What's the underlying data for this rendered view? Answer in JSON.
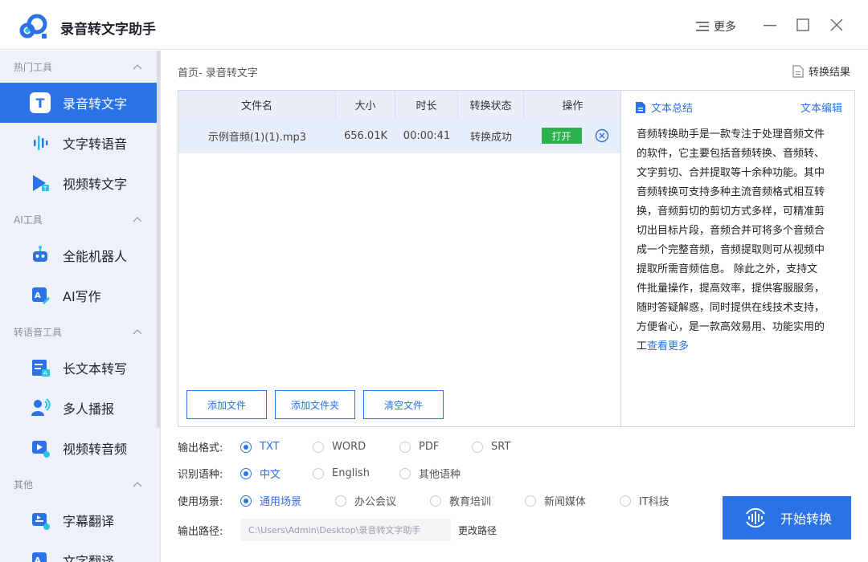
{
  "app": {
    "title": "录音转文字助手"
  },
  "titlebar": {
    "more_label": "更多"
  },
  "sidebar": {
    "sections": [
      {
        "title": "热门工具",
        "items": [
          {
            "label": "录音转文字",
            "icon": "T",
            "active": true
          },
          {
            "label": "文字转语音",
            "icon": "tts-icon"
          },
          {
            "label": "视频转文字",
            "icon": "video-text-icon"
          }
        ]
      },
      {
        "title": "AI工具",
        "items": [
          {
            "label": "全能机器人",
            "icon": "robot-icon"
          },
          {
            "label": "AI写作",
            "icon": "ai-write-icon"
          }
        ]
      },
      {
        "title": "转语音工具",
        "items": [
          {
            "label": "长文本转写",
            "icon": "long-text-icon"
          },
          {
            "label": "多人播报",
            "icon": "multi-speaker-icon"
          },
          {
            "label": "视频转音频",
            "icon": "video-audio-icon"
          }
        ]
      },
      {
        "title": "其他",
        "items": [
          {
            "label": "字幕翻译",
            "icon": "subtitle-icon"
          },
          {
            "label": "文字翻译",
            "icon": "translate-icon"
          }
        ]
      }
    ]
  },
  "main": {
    "breadcrumb": "首页- 录音转文字",
    "result_link": "转换结果"
  },
  "table": {
    "headers": [
      "文件名",
      "大小",
      "时长",
      "转换状态",
      "操作"
    ],
    "rows": [
      {
        "name": "示例音频(1)(1).mp3",
        "size": "656.01K",
        "duration": "00:00:41",
        "status": "转换成功",
        "action": "打开"
      }
    ]
  },
  "file_buttons": {
    "add_file": "添加文件",
    "add_folder": "添加文件夹",
    "clear": "清空文件"
  },
  "summary": {
    "title": "文本总结",
    "edit": "文本编辑",
    "lines": [
      "音频转换助手是一款专注于处理音频文件",
      "的软件，它主要包括音频转换、音频转、",
      "文字剪切、合并提取等十余种功能。其中",
      "音频转换可支持多种主流音频格式相互转",
      "换，音频剪切的剪切方式多样，可精准剪",
      "切出目标片段，音频合并可将多个音频合",
      "成一个完整音频，音频提取则可从视频中",
      "提取所需音频信息。 除此之外，支持文",
      "件批量操作，提高效率，提供客服服务，",
      "随时答疑解惑，同时提供在线技术支持，",
      "方便省心，是一款高效易用、功能实用的"
    ],
    "last_line": "工",
    "see_more": "查看更多"
  },
  "options": {
    "format": {
      "label": "输出格式:",
      "choices": [
        "TXT",
        "WORD",
        "PDF",
        "SRT"
      ],
      "selected": "TXT"
    },
    "language": {
      "label": "识别语种:",
      "choices": [
        "中文",
        "English",
        "其他语种"
      ],
      "selected": "中文"
    },
    "scene": {
      "label": "使用场景:",
      "choices": [
        "通用场景",
        "办公会议",
        "教育培训",
        "新闻媒体",
        "IT科技"
      ],
      "selected": "通用场景"
    },
    "path": {
      "label": "输出路径:",
      "value": "C:\\Users\\Admin\\Desktop\\录音转文字助手",
      "change": "更改路径"
    }
  },
  "start_button": {
    "label": "开始转换"
  },
  "colors": {
    "accent": "#2a72e5",
    "success": "#2bb24c"
  }
}
